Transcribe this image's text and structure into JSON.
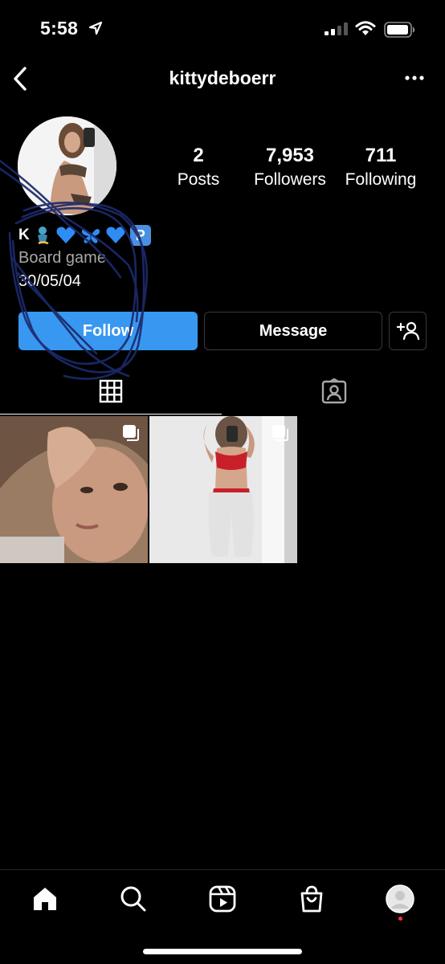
{
  "status_bar": {
    "time": "5:58"
  },
  "header": {
    "username": "kittydeboerr",
    "back_icon": "chevron-left-icon",
    "more_icon": "ellipsis-icon"
  },
  "stats": {
    "posts": {
      "value": "2",
      "label": "Posts"
    },
    "followers": {
      "value": "7,953",
      "label": "Followers"
    },
    "following": {
      "value": "711",
      "label": "Following"
    }
  },
  "bio": {
    "name_initial": "K",
    "emojis": [
      "genie",
      "blue-heart",
      "butterfly",
      "blue-heart",
      "parking-badge"
    ],
    "p_badge": "P",
    "category": "Board game",
    "date_text": "30/05/04"
  },
  "actions": {
    "follow_label": "Follow",
    "message_label": "Message",
    "add_user_icon": "add-user-icon"
  },
  "tabs": [
    {
      "name": "grid",
      "icon": "grid-icon",
      "active": true
    },
    {
      "name": "tagged",
      "icon": "tagged-icon",
      "active": false
    }
  ],
  "posts": [
    {
      "type": "photo",
      "multi": true
    },
    {
      "type": "photo",
      "multi": true
    }
  ],
  "bottom_nav": [
    "home-icon",
    "search-icon",
    "reels-icon",
    "shop-icon",
    "profile-avatar"
  ],
  "colors": {
    "background": "#000000",
    "follow_button": "#3897f0",
    "secondary_text": "#a8a8a8",
    "notification_dot": "#ff3040",
    "scribble_ink": "#1c2a6b"
  }
}
